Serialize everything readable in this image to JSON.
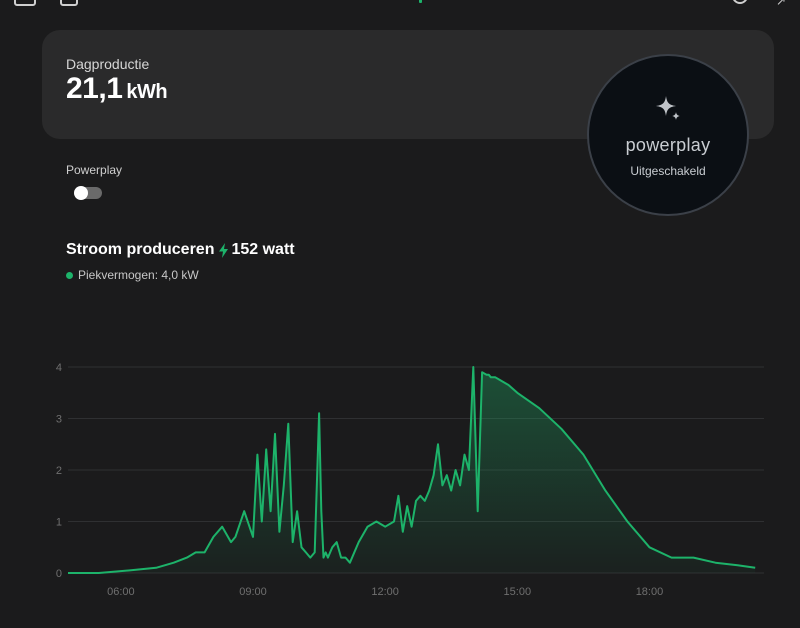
{
  "summary": {
    "label": "Dagproductie",
    "value": "21,1",
    "unit": "kWh"
  },
  "powerplay": {
    "title": "powerplay",
    "status": "Uitgeschakeld",
    "toggle_label": "Powerplay",
    "toggle_on": false,
    "icon": "sparkle-icon"
  },
  "production": {
    "title": "Stroom produceren",
    "value": "152 watt",
    "icon": "lightning-bolt-icon",
    "peak_label": "Piekvermogen: 4,0 kW"
  },
  "colors": {
    "accent": "#1db36a",
    "background": "#1b1b1c",
    "card": "#2a2a2b"
  },
  "chart_data": {
    "type": "area",
    "x_unit": "hours",
    "xlim": [
      4.8,
      20.6
    ],
    "ylim": [
      0,
      4
    ],
    "y_ticks": [
      "0",
      "1",
      "2",
      "3",
      "4"
    ],
    "x_ticks": [
      "06:00",
      "09:00",
      "12:00",
      "15:00",
      "18:00"
    ],
    "grid": true,
    "series": [
      {
        "x": [
          4.8,
          5.5,
          6.2,
          6.8,
          7.2,
          7.5,
          7.7,
          7.9,
          8.1,
          8.3,
          8.5,
          8.6,
          8.8,
          9.0,
          9.1,
          9.2,
          9.3,
          9.4,
          9.5,
          9.6,
          9.7,
          9.8,
          9.9,
          10.0,
          10.1,
          10.2,
          10.3,
          10.4,
          10.5,
          10.55,
          10.6,
          10.65,
          10.7,
          10.8,
          10.9,
          11.0,
          11.1,
          11.2,
          11.4,
          11.6,
          11.8,
          12.0,
          12.2,
          12.3,
          12.4,
          12.5,
          12.6,
          12.7,
          12.8,
          12.9,
          13.0,
          13.1,
          13.2,
          13.3,
          13.4,
          13.5,
          13.6,
          13.7,
          13.8,
          13.9,
          14.0,
          14.1,
          14.2,
          14.3,
          14.35,
          14.4,
          14.45,
          14.5,
          14.6,
          14.8,
          15.0,
          15.5,
          16.0,
          16.5,
          17.0,
          17.5,
          18.0,
          18.5,
          19.0,
          19.5,
          20.0,
          20.4
        ],
        "y": [
          0.0,
          0.0,
          0.05,
          0.1,
          0.2,
          0.3,
          0.4,
          0.4,
          0.7,
          0.9,
          0.6,
          0.7,
          1.2,
          0.7,
          2.3,
          1.0,
          2.4,
          1.2,
          2.7,
          0.8,
          1.7,
          2.9,
          0.6,
          1.2,
          0.5,
          0.4,
          0.3,
          0.4,
          3.1,
          1.2,
          0.3,
          0.4,
          0.3,
          0.5,
          0.6,
          0.3,
          0.3,
          0.2,
          0.6,
          0.9,
          1.0,
          0.9,
          1.0,
          1.5,
          0.8,
          1.3,
          0.9,
          1.4,
          1.5,
          1.4,
          1.6,
          1.9,
          2.5,
          1.7,
          1.9,
          1.6,
          2.0,
          1.7,
          2.3,
          2.0,
          4.0,
          1.2,
          3.9,
          3.85,
          3.85,
          3.8,
          3.8,
          3.8,
          3.75,
          3.65,
          3.5,
          3.2,
          2.8,
          2.3,
          1.6,
          1.0,
          0.5,
          0.3,
          0.3,
          0.2,
          0.15,
          0.1
        ]
      }
    ]
  }
}
